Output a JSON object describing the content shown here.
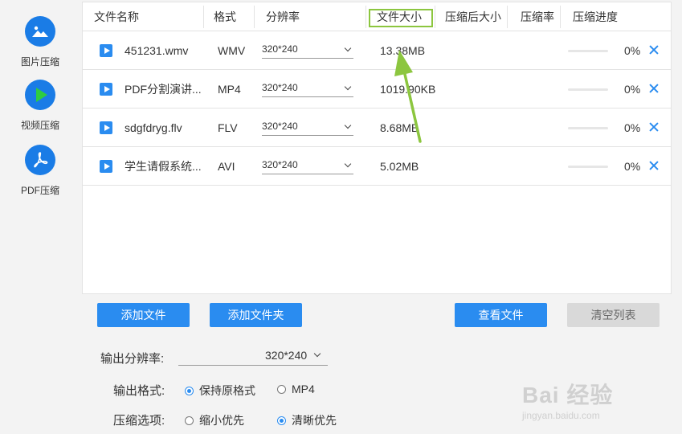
{
  "sidebar": {
    "items": [
      {
        "label": "图片压缩",
        "icon": "image-icon"
      },
      {
        "label": "视频压缩",
        "icon": "play-icon"
      },
      {
        "label": "PDF压缩",
        "icon": "pdf-icon"
      }
    ]
  },
  "table": {
    "headers": [
      "文件名称",
      "格式",
      "分辨率",
      "文件大小",
      "压缩后大小",
      "压缩率",
      "压缩进度"
    ],
    "rows": [
      {
        "name": "451231.wmv",
        "format": "WMV",
        "resolution": "320*240",
        "size": "13.38MB",
        "compressed_size": "",
        "ratio": "",
        "progress": 0,
        "progress_text": "0%"
      },
      {
        "name": "PDF分割演讲...",
        "format": "MP4",
        "resolution": "320*240",
        "size": "1019.90KB",
        "compressed_size": "",
        "ratio": "",
        "progress": 0,
        "progress_text": "0%"
      },
      {
        "name": "sdgfdryg.flv",
        "format": "FLV",
        "resolution": "320*240",
        "size": "8.68MB",
        "compressed_size": "",
        "ratio": "",
        "progress": 0,
        "progress_text": "0%"
      },
      {
        "name": "学生请假系统...",
        "format": "AVI",
        "resolution": "320*240",
        "size": "5.02MB",
        "compressed_size": "",
        "ratio": "",
        "progress": 0,
        "progress_text": "0%"
      }
    ]
  },
  "buttons": {
    "add_file": "添加文件",
    "add_folder": "添加文件夹",
    "view_files": "查看文件",
    "clear_list": "清空列表"
  },
  "settings": {
    "output_resolution_label": "输出分辨率:",
    "output_resolution_value": "320*240",
    "output_format_label": "输出格式:",
    "format_options": [
      {
        "label": "保持原格式",
        "selected": true
      },
      {
        "label": "MP4",
        "selected": false
      }
    ],
    "compress_option_label": "压缩选项:",
    "compress_options": [
      {
        "label": "缩小优先",
        "selected": false
      },
      {
        "label": "清晰优先",
        "selected": true
      }
    ]
  },
  "watermark": {
    "main": "Bai 经验",
    "sub": "jingyan.baidu.com"
  },
  "colors": {
    "accent": "#2a8cf0",
    "sidebar_icon": "#1a7ce6",
    "highlight_box": "#8cc63f",
    "annotation_arrow": "#8cc63f"
  }
}
